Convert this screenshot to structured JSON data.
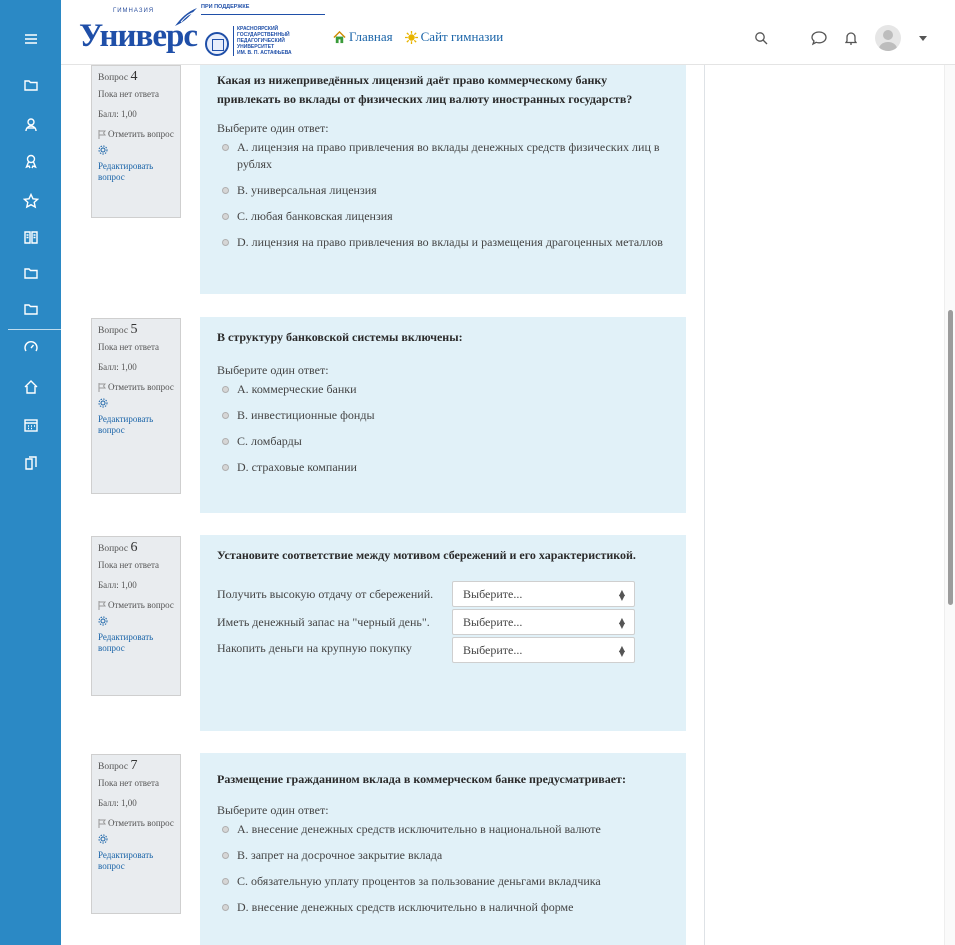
{
  "header": {
    "logo": {
      "small": "ГИМНАЗИЯ",
      "brand": "Универс",
      "support": "ПРИ ПОДДЕРЖКЕ",
      "university_lines": [
        "КРАСНОЯРСКИЙ",
        "ГОСУДАРСТВЕННЫЙ",
        "ПЕДАГОГИЧЕСКИЙ",
        "УНИВЕРСИТЕТ",
        "ИМ. В. П. АСТАФЬЕВА"
      ]
    },
    "links": [
      {
        "label": "Главная",
        "icon": "home-icon"
      },
      {
        "label": "Сайт гимназии",
        "icon": "sun-icon"
      }
    ],
    "icons": [
      "search-icon",
      "chat-icon",
      "bell-icon",
      "avatar",
      "caret-down-icon"
    ]
  },
  "sidebar": {
    "items": [
      "menu-icon",
      "folder-icon",
      "users-icon",
      "badge-icon",
      "star-icon",
      "book-icon",
      "folder-icon",
      "folder-icon",
      "dashboard-icon",
      "home-icon",
      "calendar-icon",
      "files-icon"
    ]
  },
  "colors": {
    "sidebar": "#2b89c5",
    "question_bg": "#e1f1f8",
    "info_bg": "#e9ecef",
    "link": "#1a64a8"
  },
  "questions": [
    {
      "label": "Вопрос",
      "number": "4",
      "state": "Пока нет ответа",
      "grade": "Балл: 1,00",
      "flag_label": "Отметить вопрос",
      "edit_label": "Редактировать вопрос",
      "text": "Какая из нижеприведённых лицензий даёт право коммерческому банку привлекать во вклады от физических лиц валюту иностранных государств?",
      "prompt": "Выберите один ответ:",
      "answers": [
        "A. лицензия на право привлечения во вклады денежных средств физических лиц в рублях",
        "B. универсальная лицензия",
        "C. любая банковская лицензия",
        "D. лицензия на право привлечения во вклады и размещения драгоценных металлов"
      ]
    },
    {
      "label": "Вопрос",
      "number": "5",
      "state": "Пока нет ответа",
      "grade": "Балл: 1,00",
      "flag_label": "Отметить вопрос",
      "edit_label": "Редактировать вопрос",
      "text": "В структуру банковской системы включены:",
      "prompt": "Выберите один ответ:",
      "answers": [
        "A. коммерческие банки",
        "B. инвестиционные фонды",
        "C. ломбарды",
        "D. страховые компании"
      ]
    },
    {
      "label": "Вопрос",
      "number": "6",
      "state": "Пока нет ответа",
      "grade": "Балл: 1,00",
      "flag_label": "Отметить вопрос",
      "edit_label": "Редактировать вопрос",
      "text": "Установите соответствие между мотивом сбережений и его характеристикой.",
      "matches": [
        {
          "label": "Получить высокую отдачу от сбережений.",
          "value": "Выберите..."
        },
        {
          "label": "Иметь денежный запас на \"черный день\".",
          "value": "Выберите..."
        },
        {
          "label": "Накопить деньги на крупную покупку",
          "value": "Выберите..."
        }
      ]
    },
    {
      "label": "Вопрос",
      "number": "7",
      "state": "Пока нет ответа",
      "grade": "Балл: 1,00",
      "flag_label": "Отметить вопрос",
      "edit_label": "Редактировать вопрос",
      "text": "Размещение гражданином вклада в коммерческом банке предусматривает:",
      "prompt": "Выберите один ответ:",
      "answers": [
        "A. внесение денежных средств исключительно в национальной валюте",
        "B. запрет на досрочное закрытие вклада",
        "C. обязательную уплату процентов за пользование деньгами вкладчика",
        "D. внесение денежных средств исключительно в наличной форме"
      ]
    }
  ]
}
